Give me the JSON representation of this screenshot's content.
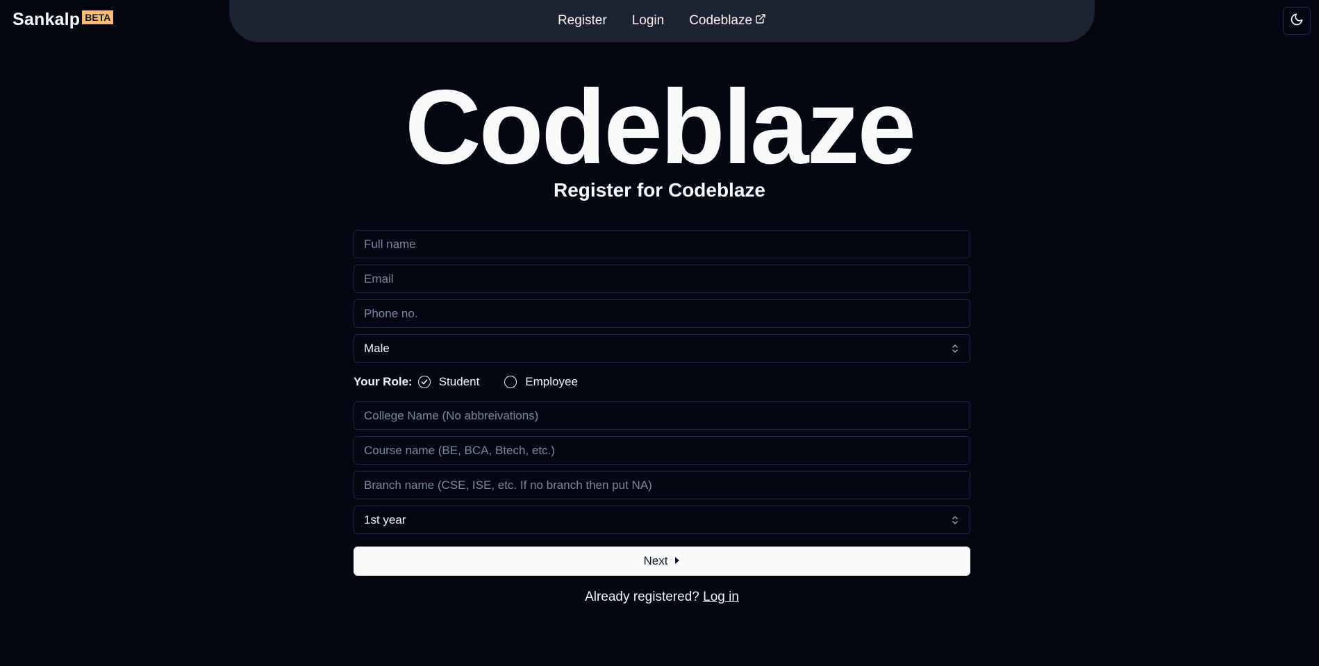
{
  "brand": {
    "name": "Sankalp",
    "badge": "BETA"
  },
  "nav": {
    "items": [
      {
        "label": "Register"
      },
      {
        "label": "Login"
      },
      {
        "label": "Codeblaze",
        "icon": "external-link-icon"
      }
    ]
  },
  "theme_toggle": {
    "icon": "moon-icon"
  },
  "hero": {
    "title": "Codeblaze",
    "subtitle": "Register for Codeblaze"
  },
  "form": {
    "full_name": {
      "placeholder": "Full name",
      "value": ""
    },
    "email": {
      "placeholder": "Email",
      "value": ""
    },
    "phone": {
      "placeholder": "Phone no.",
      "value": ""
    },
    "gender": {
      "selected": "Male"
    },
    "role": {
      "label": "Your Role:",
      "options": [
        "Student",
        "Employee"
      ],
      "selected": "Student"
    },
    "college": {
      "placeholder": "College Name (No abbreivations)",
      "value": ""
    },
    "course": {
      "placeholder": "Course name (BE, BCA, Btech, etc.)",
      "value": ""
    },
    "branch": {
      "placeholder": "Branch name (CSE, ISE, etc. If no branch then put NA)",
      "value": ""
    },
    "year": {
      "selected": "1st year"
    },
    "next_label": "Next",
    "footer_text": "Already registered?",
    "footer_link": "Log in"
  },
  "colors": {
    "background": "#030712",
    "nav_background": "#1e2330",
    "badge": "#fdba74",
    "button": "#f8fafc"
  }
}
